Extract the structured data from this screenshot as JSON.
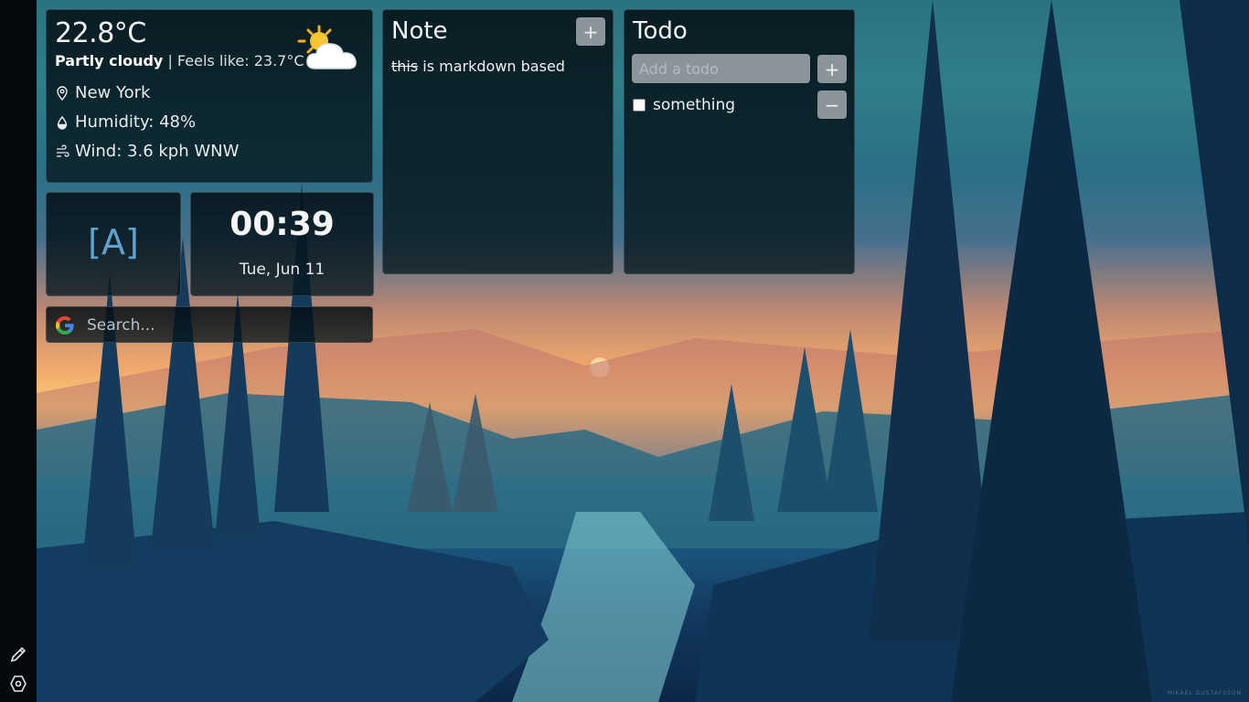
{
  "weather": {
    "temperature": "22.8°C",
    "condition": "Partly cloudy",
    "feels_like": "| Feels like: 23.7°C",
    "location": "New York",
    "humidity": "Humidity: 48%",
    "wind": "Wind: 3.6 kph WNW",
    "icon": "partly-cloudy-icon"
  },
  "logo": {
    "text": "[A]"
  },
  "clock": {
    "time": "00:39",
    "date": "Tue, Jun 11"
  },
  "search": {
    "placeholder": "Search...",
    "engine_icon": "google-icon"
  },
  "note": {
    "title": "Note",
    "add_label": "+",
    "strikethrough_text": "this",
    "body_text": " is markdown based"
  },
  "todo": {
    "title": "Todo",
    "input_placeholder": "Add a todo",
    "add_label": "+",
    "items": [
      {
        "label": "something",
        "done": false,
        "remove_label": "−"
      }
    ]
  },
  "rail": {
    "edit_icon": "pencil-icon",
    "settings_icon": "settings-hexagon-icon"
  },
  "credit": "MIKAEL GUSTAFSSON"
}
